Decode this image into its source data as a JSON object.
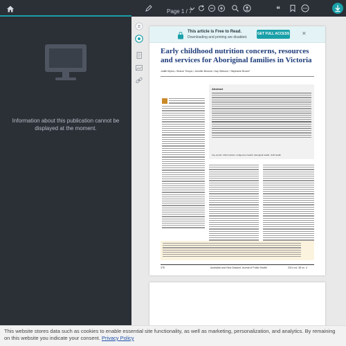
{
  "toolbar": {
    "page_indicator": "Page 1 / 7",
    "icons": [
      "home-icon",
      "pen-icon",
      "refresh-icon",
      "zoom-out-icon",
      "zoom-in-icon",
      "search-icon",
      "user-icon",
      "quote-icon",
      "bookmark-icon",
      "more-icon",
      "download-icon"
    ],
    "accent": "#1aa0a8"
  },
  "left_panel": {
    "message": "Information about this publication cannot be displayed at the moment."
  },
  "banner": {
    "title": "This article is Free to Read.",
    "subtitle": "Downloading and printing are disabled.",
    "button": "GET FULL ACCESS"
  },
  "article": {
    "title": "Early childhood nutrition concerns, resources and services for Aboriginal families in Victoria",
    "authors": "Judith Myers,¹ Sharon Thorpe,² Jennifer Browne,³ Kay Gibbons,⁴ Stephanie Brown⁵",
    "abstract_heading": "Abstract",
    "keywords": "Key words: Child nutrition, Indigenous health, Aboriginal health, child health",
    "footer_page": "378",
    "footer_journal": "Australian and New Zealand Journal of Public Health",
    "footer_year": "2014 vol. 38 no. 4"
  },
  "cookie": {
    "text": "This website stores data such as cookies to enable essential site functionality, as well as marketing, personalization, and analytics. By remaining on this website you indicate your consent.",
    "link": "Privacy Policy"
  }
}
